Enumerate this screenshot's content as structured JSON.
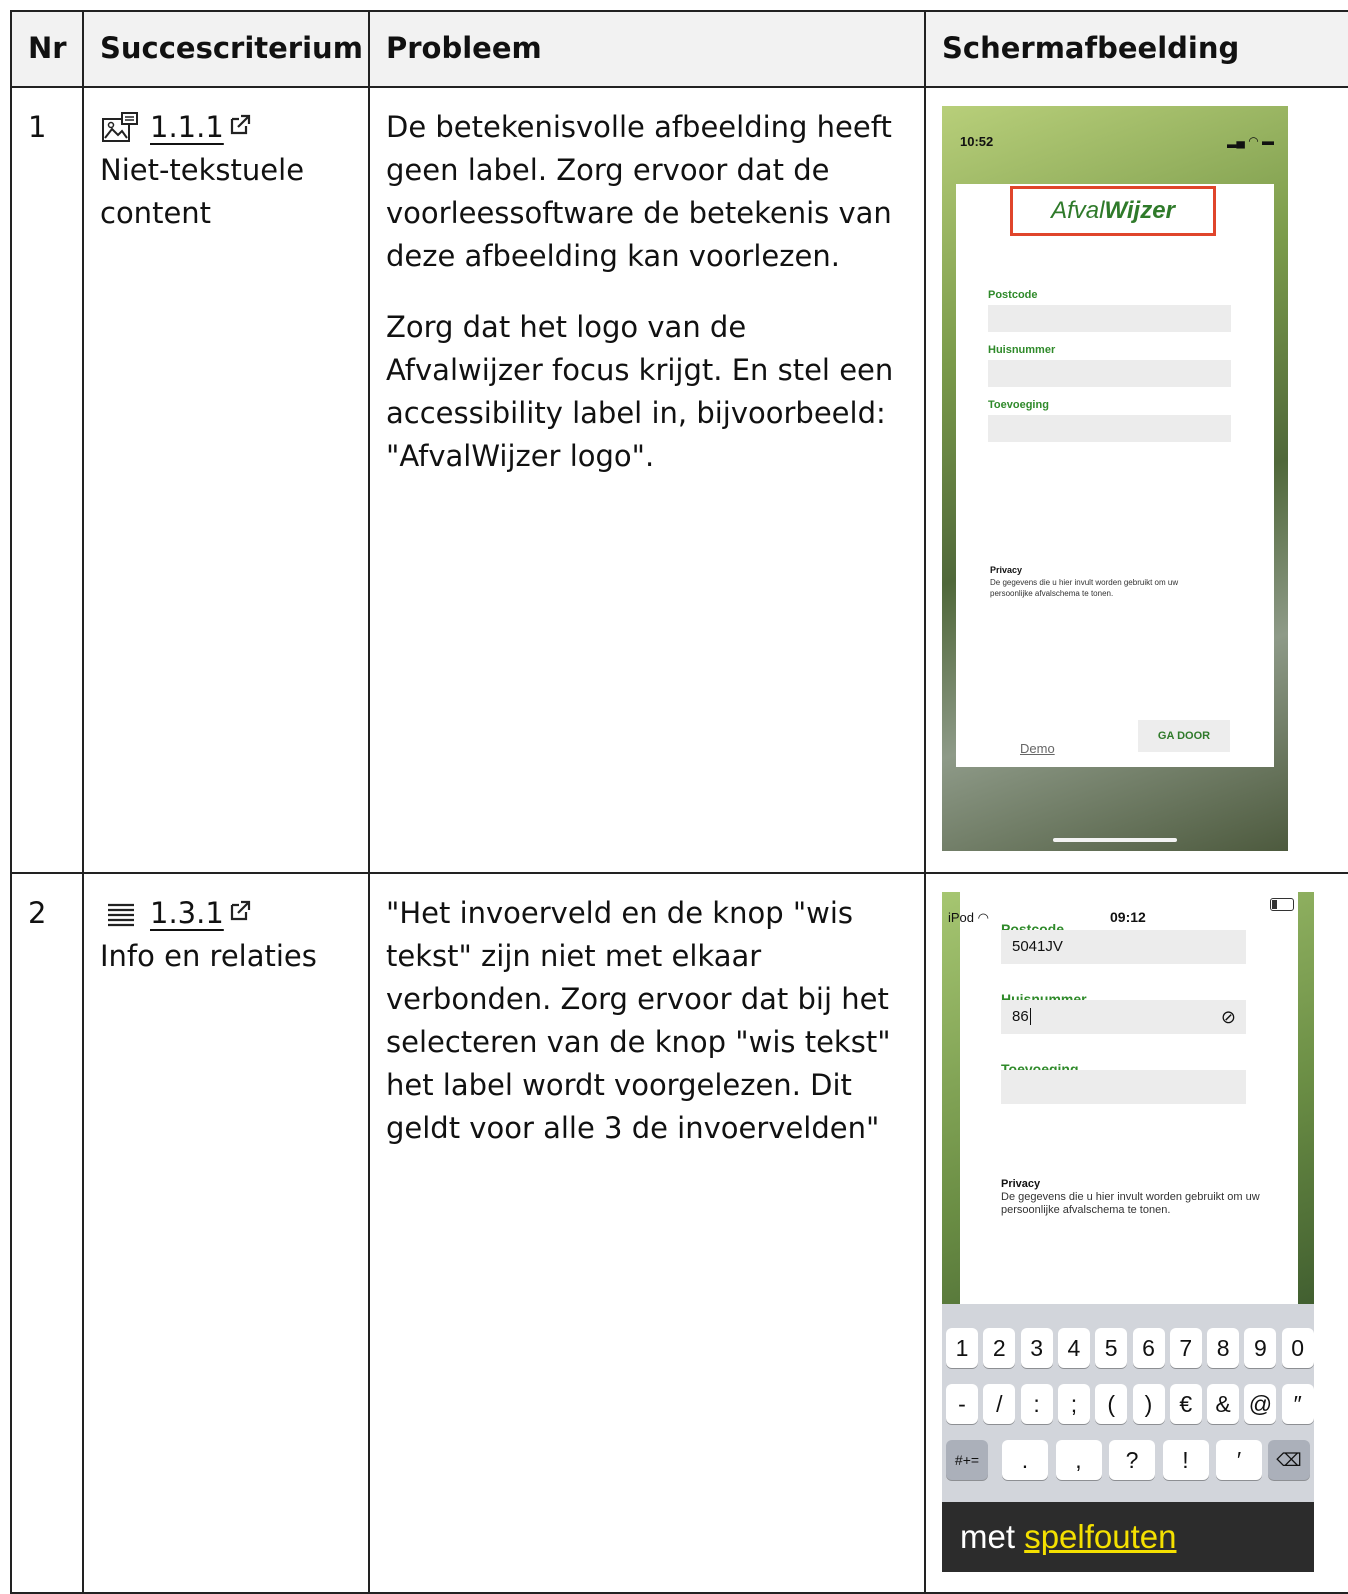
{
  "table": {
    "headers": [
      "Nr",
      "Succescriterium",
      "Probleem",
      "Schermafbeelding"
    ]
  },
  "rows": [
    {
      "nr": "1",
      "icon": "image-icon",
      "criterion_code": "1.1.1",
      "criterion_name": "Niet-tekstuele content",
      "problem_paragraphs": [
        "De betekenisvolle afbeelding heeft geen label. Zorg ervoor dat de voorleessoftware de betekenis van deze afbeelding kan voorlezen.",
        "Zorg dat het logo van de Afvalwijzer focus krijgt. En stel een accessibility label in, bijvoorbeeld: \"AfvalWijzer logo\"."
      ],
      "screenshot": {
        "status_time": "10:52",
        "logo_part1": "Afval",
        "logo_part2": "Wijzer",
        "fields": [
          "Postcode",
          "Huisnummer",
          "Toevoeging"
        ],
        "privacy_title": "Privacy",
        "privacy_text": "De gegevens die u hier invult worden gebruikt om uw persoonlijke afvalschema te tonen.",
        "demo": "Demo",
        "continue": "GA DOOR"
      }
    },
    {
      "nr": "2",
      "icon": "list-icon",
      "criterion_code": "1.3.1",
      "criterion_name": "Info en relaties",
      "problem_paragraphs": [
        "\"Het invoerveld en de knop \"wis tekst\" zijn niet met elkaar verbonden. Zorg ervoor dat bij het selecteren van de knop \"wis tekst\" het label wordt voorgelezen. Dit geldt voor alle 3 de invoervelden\""
      ],
      "screenshot": {
        "status_device": "iPod",
        "status_time": "09:12",
        "fields": [
          {
            "label": "Postcode",
            "value": "5041JV"
          },
          {
            "label": "Huisnummer",
            "value": "86"
          },
          {
            "label": "Toevoeging",
            "value": ""
          }
        ],
        "privacy_title": "Privacy",
        "privacy_text": "De gegevens die u hier invult worden gebruikt om uw persoonlijke afvalschema te tonen.",
        "keys_row1": [
          "1",
          "2",
          "3",
          "4",
          "5",
          "6",
          "7",
          "8",
          "9",
          "0"
        ],
        "keys_row2": [
          "-",
          "/",
          ":",
          ";",
          "(",
          ")",
          "€",
          "&",
          "@",
          "″"
        ],
        "keys_row3": [
          ".",
          ",",
          "?",
          "!",
          "′"
        ],
        "key_symbols": "#+=",
        "caption_plain": "met",
        "caption_highlight": "spelfouten"
      }
    }
  ],
  "colors": {
    "brand_green": "#2f7a2a",
    "highlight_red": "#e0452b",
    "caption_yellow": "#f4e000"
  }
}
